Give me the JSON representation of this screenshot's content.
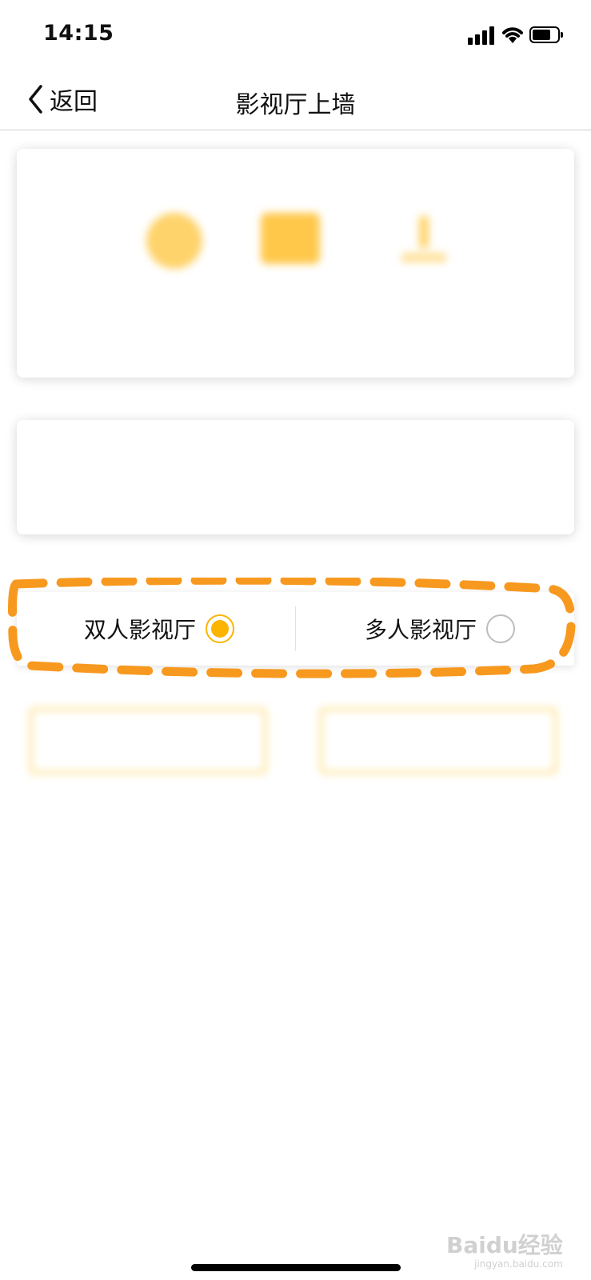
{
  "status_bar": {
    "time": "14:15",
    "icons": [
      "cellular-signal-icon",
      "wifi-icon",
      "battery-icon"
    ]
  },
  "nav": {
    "back_label": "返回",
    "title": "影视厅上墙"
  },
  "media_options": [
    {
      "icon": "film-reel-icon",
      "label": ""
    },
    {
      "icon": "video-icon",
      "label": ""
    },
    {
      "icon": "upload-icon",
      "label": ""
    }
  ],
  "text_input": {
    "placeholder": ""
  },
  "hall_type": {
    "options": [
      {
        "label": "双人影视厅",
        "selected": true
      },
      {
        "label": "多人影视厅",
        "selected": false
      }
    ],
    "accent_color": "#FBB400"
  },
  "actions": {
    "left_label": "",
    "right_label": ""
  },
  "highlight_color": "#F7991F",
  "watermark": {
    "text": "Baidu经验",
    "subtext": "jingyan.baidu.com"
  }
}
